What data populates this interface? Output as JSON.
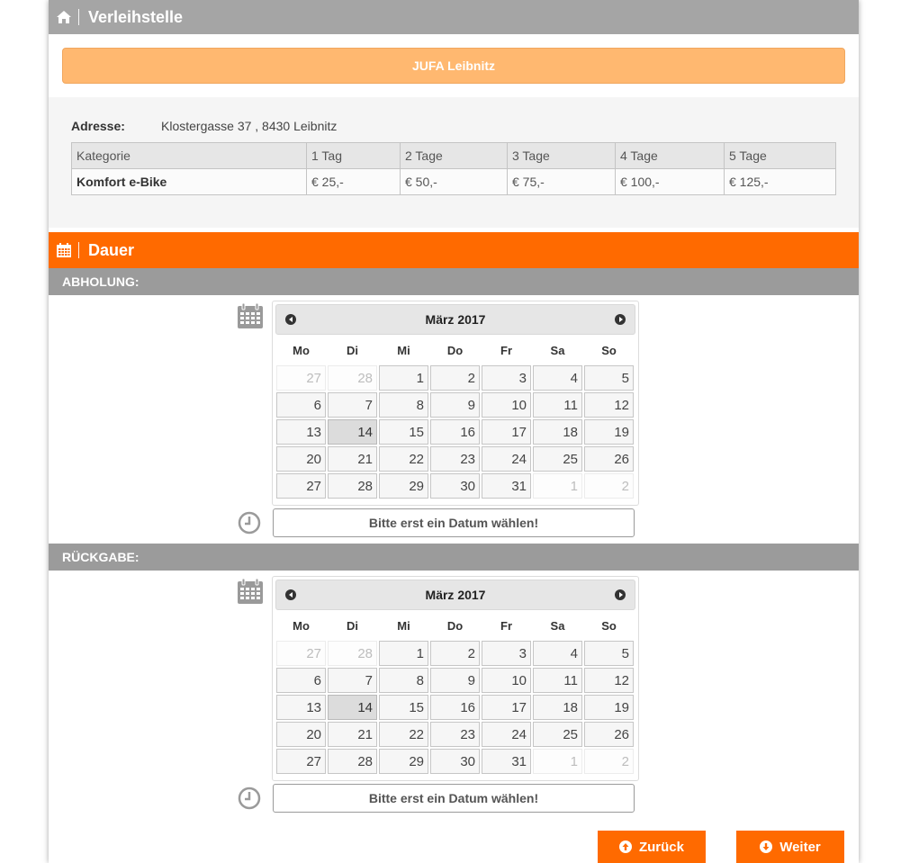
{
  "rental_section": {
    "title": "Verleihstelle",
    "location_button": "JUFA Leibnitz",
    "address_label": "Adresse:",
    "address_value": "Klostergasse 37 , 8430 Leibnitz",
    "table": {
      "headers": [
        "Kategorie",
        "1 Tag",
        "2 Tage",
        "3 Tage",
        "4 Tage",
        "5 Tage"
      ],
      "row": [
        "Komfort e-Bike",
        "€ 25,-",
        "€ 50,-",
        "€ 75,-",
        "€ 100,-",
        "€ 125,-"
      ]
    }
  },
  "duration_section": {
    "title": "Dauer"
  },
  "pickup": {
    "label": "ABHOLUNG:",
    "calendar": {
      "title": "März 2017",
      "weekdays": [
        "Mo",
        "Di",
        "Mi",
        "Do",
        "Fr",
        "Sa",
        "So"
      ],
      "weeks": [
        [
          {
            "d": "27",
            "o": true
          },
          {
            "d": "28",
            "o": true
          },
          {
            "d": "1"
          },
          {
            "d": "2"
          },
          {
            "d": "3"
          },
          {
            "d": "4"
          },
          {
            "d": "5"
          }
        ],
        [
          {
            "d": "6"
          },
          {
            "d": "7"
          },
          {
            "d": "8"
          },
          {
            "d": "9"
          },
          {
            "d": "10"
          },
          {
            "d": "11"
          },
          {
            "d": "12"
          }
        ],
        [
          {
            "d": "13"
          },
          {
            "d": "14",
            "t": true
          },
          {
            "d": "15"
          },
          {
            "d": "16"
          },
          {
            "d": "17"
          },
          {
            "d": "18"
          },
          {
            "d": "19"
          }
        ],
        [
          {
            "d": "20"
          },
          {
            "d": "21"
          },
          {
            "d": "22"
          },
          {
            "d": "23"
          },
          {
            "d": "24"
          },
          {
            "d": "25"
          },
          {
            "d": "26"
          }
        ],
        [
          {
            "d": "27"
          },
          {
            "d": "28"
          },
          {
            "d": "29"
          },
          {
            "d": "30"
          },
          {
            "d": "31"
          },
          {
            "d": "1",
            "o": true
          },
          {
            "d": "2",
            "o": true
          }
        ]
      ]
    },
    "time_placeholder": "Bitte erst ein Datum wählen!"
  },
  "return": {
    "label": "RÜCKGABE:",
    "calendar": {
      "title": "März 2017",
      "weekdays": [
        "Mo",
        "Di",
        "Mi",
        "Do",
        "Fr",
        "Sa",
        "So"
      ],
      "weeks": [
        [
          {
            "d": "27",
            "o": true
          },
          {
            "d": "28",
            "o": true
          },
          {
            "d": "1"
          },
          {
            "d": "2"
          },
          {
            "d": "3"
          },
          {
            "d": "4"
          },
          {
            "d": "5"
          }
        ],
        [
          {
            "d": "6"
          },
          {
            "d": "7"
          },
          {
            "d": "8"
          },
          {
            "d": "9"
          },
          {
            "d": "10"
          },
          {
            "d": "11"
          },
          {
            "d": "12"
          }
        ],
        [
          {
            "d": "13"
          },
          {
            "d": "14",
            "t": true
          },
          {
            "d": "15"
          },
          {
            "d": "16"
          },
          {
            "d": "17"
          },
          {
            "d": "18"
          },
          {
            "d": "19"
          }
        ],
        [
          {
            "d": "20"
          },
          {
            "d": "21"
          },
          {
            "d": "22"
          },
          {
            "d": "23"
          },
          {
            "d": "24"
          },
          {
            "d": "25"
          },
          {
            "d": "26"
          }
        ],
        [
          {
            "d": "27"
          },
          {
            "d": "28"
          },
          {
            "d": "29"
          },
          {
            "d": "30"
          },
          {
            "d": "31"
          },
          {
            "d": "1",
            "o": true
          },
          {
            "d": "2",
            "o": true
          }
        ]
      ]
    },
    "time_placeholder": "Bitte erst ein Datum wählen!"
  },
  "buttons": {
    "back": "Zurück",
    "next": "Weiter"
  },
  "colors": {
    "accent": "#ff6a00",
    "header_grey": "#a5a5a5",
    "location_button": "#ffb870"
  }
}
